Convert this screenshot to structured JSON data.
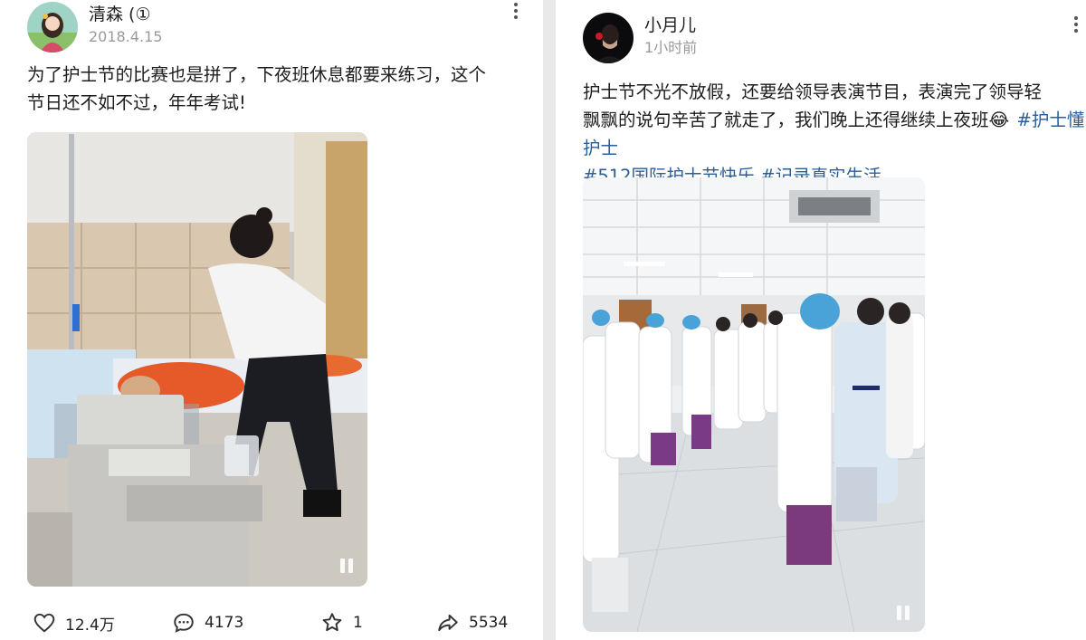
{
  "posts": [
    {
      "username": "清森 (①",
      "timestamp": "2018.4.15",
      "text_lines": [
        "为了护士节的比赛也是拼了，下夜班休息都要来练习，这个",
        "节日还不如不过，年年考试!"
      ],
      "media": {
        "kind": "video",
        "scene": "nurse practicing CPR on mannequin in ward"
      },
      "stats": {
        "likes": "12.4万",
        "comments": "4173",
        "favorites": "1",
        "shares": "5534"
      }
    },
    {
      "username": "小月儿",
      "timestamp": "1小时前",
      "text_line1": "护士节不光不放假，还要给领导表演节目，表演完了领导轻",
      "text_line2": "飘飘的说句辛苦了就走了，我们晚上还得继续上夜班",
      "emoji": "😂",
      "hashtags": [
        "#护士懂护士",
        "#512国际护士节快乐",
        "#记录真实生活"
      ],
      "media": {
        "kind": "video",
        "scene": "nurses standing in hospital hallway"
      }
    }
  ],
  "icons": [
    "more-icon",
    "heart-icon",
    "comment-icon",
    "star-icon",
    "share-icon",
    "pause-icon"
  ],
  "colors": {
    "hashtag": "#2a5f9e",
    "time": "#9a9a9a",
    "text": "#1d1d1d",
    "background": "#e9e9eb"
  }
}
